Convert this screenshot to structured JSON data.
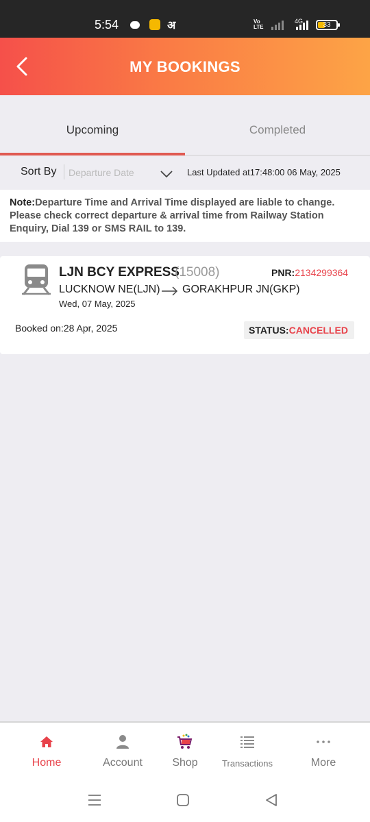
{
  "status_bar": {
    "time": "5:54",
    "hindi_glyph": "अ",
    "volte": "Vo LTE",
    "network": "4G",
    "battery": "33"
  },
  "header": {
    "title": "MY BOOKINGS"
  },
  "tabs": [
    {
      "label": "Upcoming",
      "active": true
    },
    {
      "label": "Completed",
      "active": false
    }
  ],
  "sort": {
    "label": "Sort By",
    "value": "Departure Date",
    "last_updated": "Last Updated at17:48:00 06 May, 2025"
  },
  "note": {
    "prefix": "Note:",
    "text": "Departure Time and Arrival Time displayed are liable to change. Please check correct departure & arrival time from Railway Station Enquiry, Dial 139 or SMS RAIL to 139."
  },
  "booking": {
    "train_name": "LJN BCY EXPRESS",
    "train_number": "(15008)",
    "pnr_label": "PNR:",
    "pnr": "2134299364",
    "from": "LUCKNOW NE(LJN)",
    "to": "GORAKHPUR JN(GKP)",
    "travel_date": "Wed, 07 May, 2025",
    "booked_on": "Booked on:28 Apr, 2025",
    "status_label": "STATUS:",
    "status": "CANCELLED"
  },
  "bottom_nav": [
    {
      "label": "Home",
      "icon": "home-icon",
      "active": true
    },
    {
      "label": "Account",
      "icon": "person-icon",
      "active": false
    },
    {
      "label": "Shop",
      "icon": "cart-icon",
      "active": false
    },
    {
      "label": "Transactions",
      "icon": "list-icon",
      "active": false
    },
    {
      "label": "More",
      "icon": "more-icon",
      "active": false
    }
  ],
  "colors": {
    "header_start": "#f5504a",
    "header_end": "#fda446",
    "accent_red": "#e8434b"
  }
}
